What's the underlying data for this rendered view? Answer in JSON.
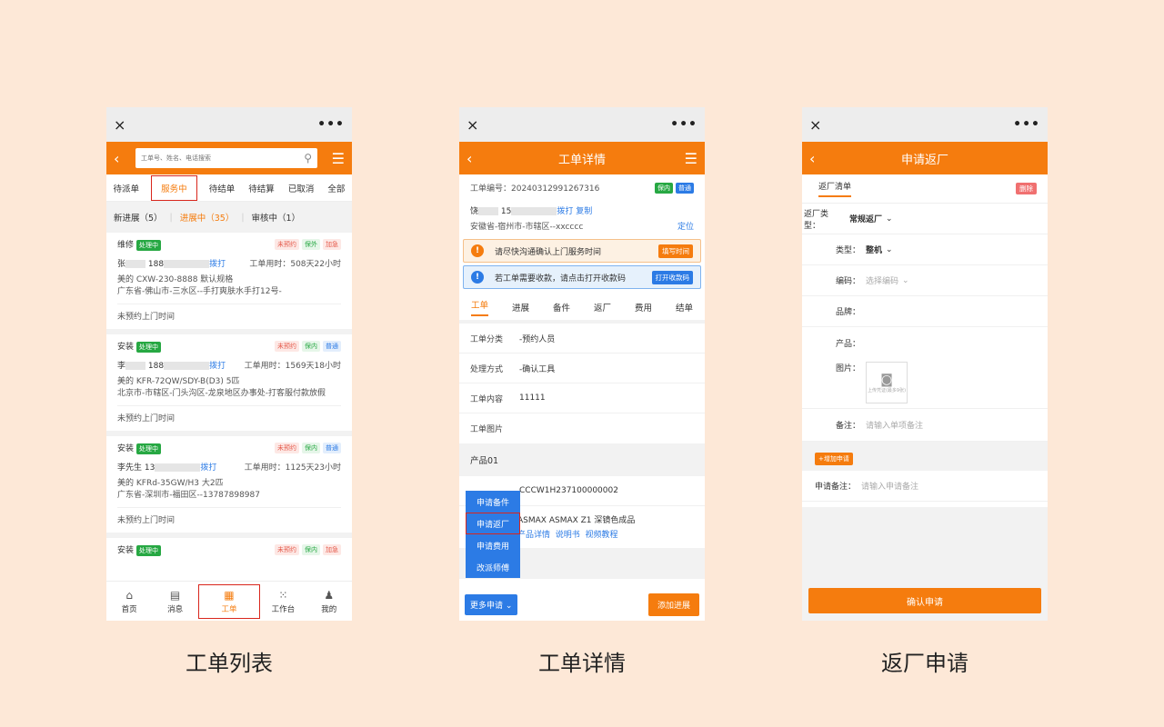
{
  "captions": [
    "工单列表",
    "工单详情",
    "返厂申请"
  ],
  "wechat": {
    "close": "×",
    "more": "•••"
  },
  "list": {
    "search_placeholder": "工单号、姓名、电话搜索",
    "tabs": [
      "待派单",
      "服务中",
      "待结单",
      "待结算",
      "已取消",
      "全部"
    ],
    "subtabs": [
      "新进展（5）",
      "进展中（35）",
      "审核中（1）"
    ],
    "cards": [
      {
        "type": "维修",
        "status": "处理中",
        "tags": [
          "未预约",
          "保外",
          "加急"
        ],
        "name": "张",
        "phone": "188",
        "call": "拨打",
        "time": "工单用时：508天22小时",
        "product": "美的 CXW-230-8888 默认规格",
        "addr": "广东省-佛山市-三水区--手打爽肤水手打12号-",
        "foot": "未预约上门时间"
      },
      {
        "type": "安装",
        "status": "处理中",
        "tags": [
          "未预约",
          "保内",
          "普通"
        ],
        "name": "李",
        "phone": "188",
        "call": "拨打",
        "time": "工单用时：1569天18小时",
        "product": "美的 KFR-72QW/SDY-B(D3) 5匹",
        "addr": "北京市-市辖区-门头沟区-龙泉地区办事处-打客服付款放假",
        "foot": "未预约上门时间"
      },
      {
        "type": "安装",
        "status": "处理中",
        "tags": [
          "未预约",
          "保内",
          "普通"
        ],
        "name": "李先生",
        "phone": "13",
        "call": "拨打",
        "time": "工单用时：1125天23小时",
        "product": "美的 KFRd-35GW/H3 大2匹",
        "addr": "广东省-深圳市-福田区--13787898987",
        "foot": "未预约上门时间"
      },
      {
        "type": "安装",
        "status": "处理中",
        "tags": [
          "未预约",
          "保内",
          "加急"
        ]
      }
    ],
    "bottom_nav": [
      "首页",
      "消息",
      "工单",
      "工作台",
      "我的"
    ]
  },
  "detail": {
    "title": "工单详情",
    "order_no": "工单编号：20240312991267316",
    "badges": [
      "保内",
      "普通"
    ],
    "name": "饶",
    "phone": "15",
    "call": "拨打",
    "copy": "复制",
    "addr": "安徽省-宿州市-市辖区--xxcccc",
    "locate": "定位",
    "notice1": "请尽快沟通确认上门服务时间",
    "notice1_btn": "填写时间",
    "notice2": "若工单需要收款，请点击打开收款码",
    "notice2_btn": "打开收款码",
    "tabs": [
      "工单",
      "进展",
      "备件",
      "返厂",
      "费用",
      "结单"
    ],
    "fields": [
      {
        "k": "工单分类",
        "v": "-预约人员"
      },
      {
        "k": "处理方式",
        "v": "-确认工具"
      },
      {
        "k": "工单内容",
        "v": "11111"
      },
      {
        "k": "工单图片",
        "v": ""
      }
    ],
    "product_header": "产品01",
    "product_code": "CCCW1H237100000002",
    "product_name": "ASMAX ASMAX Z1 深镜色成品",
    "product_links": [
      "产品详情",
      "说明书",
      "视频教程"
    ],
    "popup": [
      "申请备件",
      "申请返厂",
      "申请费用",
      "改派师傅"
    ],
    "more_btn": "更多申请",
    "add_btn": "添加进展"
  },
  "return": {
    "title": "申请返厂",
    "tab": "返厂清单",
    "delete": "删除",
    "rows": [
      {
        "k": "返厂类型：",
        "v": "常规返厂"
      },
      {
        "k": "类型：",
        "v": "整机"
      },
      {
        "k": "编码：",
        "v": "选择编码"
      },
      {
        "k": "品牌：",
        "v": ""
      },
      {
        "k": "产品：",
        "v": ""
      }
    ],
    "image_label": "图片：",
    "upload_hint": "上传凭证(最多9张)",
    "remark_label": "备注：",
    "remark_placeholder": "请输入单项备注",
    "add_btn": "+增加申请",
    "apply_remark_label": "申请备注：",
    "apply_remark_placeholder": "请输入申请备注",
    "confirm": "确认申请"
  },
  "colors": {
    "brand": "#f57c0e",
    "blue": "#2c7be5",
    "green": "#27a843",
    "highlight": "#d9261c"
  }
}
